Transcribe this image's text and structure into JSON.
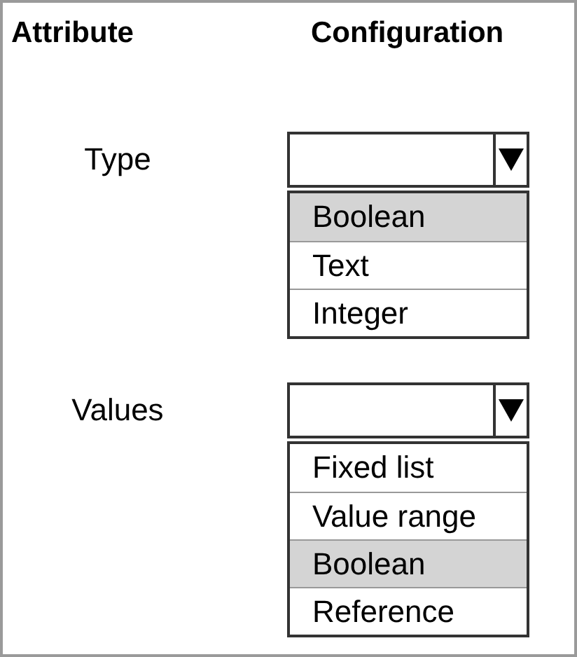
{
  "headers": [
    "Attribute",
    "Configuration"
  ],
  "rows": [
    {
      "label": "Type",
      "options": [
        {
          "label": "Boolean",
          "selected": true
        },
        {
          "label": "Text",
          "selected": false
        },
        {
          "label": "Integer",
          "selected": false
        }
      ]
    },
    {
      "label": "Values",
      "options": [
        {
          "label": "Fixed list",
          "selected": false
        },
        {
          "label": "Value range",
          "selected": false
        },
        {
          "label": "Boolean",
          "selected": true
        },
        {
          "label": "Reference",
          "selected": false
        }
      ]
    }
  ]
}
